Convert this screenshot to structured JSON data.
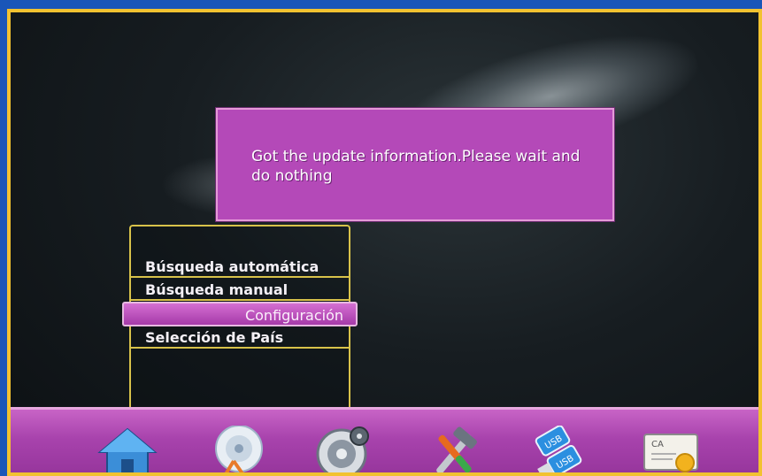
{
  "dialog": {
    "message": "Got the update information.Please wait and do nothing"
  },
  "menu": {
    "items": [
      {
        "label": "Búsqueda automática"
      },
      {
        "label": "Búsqueda manual"
      },
      {
        "label": "Configuración",
        "selected": true
      },
      {
        "label": "Selección de País"
      }
    ]
  },
  "toolbar": {
    "icons": [
      "home-icon",
      "satellite-dish-icon",
      "film-reel-icon",
      "tools-icon",
      "usb-icon",
      "ca-card-icon"
    ],
    "usb_label_1": "USB",
    "usb_label_2": "USB",
    "ca_label": "CA"
  },
  "colors": {
    "accent": "#b449b8",
    "menu_border": "#d8c24a",
    "frame_outer": "#1a56b8",
    "frame_inner": "#f2c230"
  }
}
